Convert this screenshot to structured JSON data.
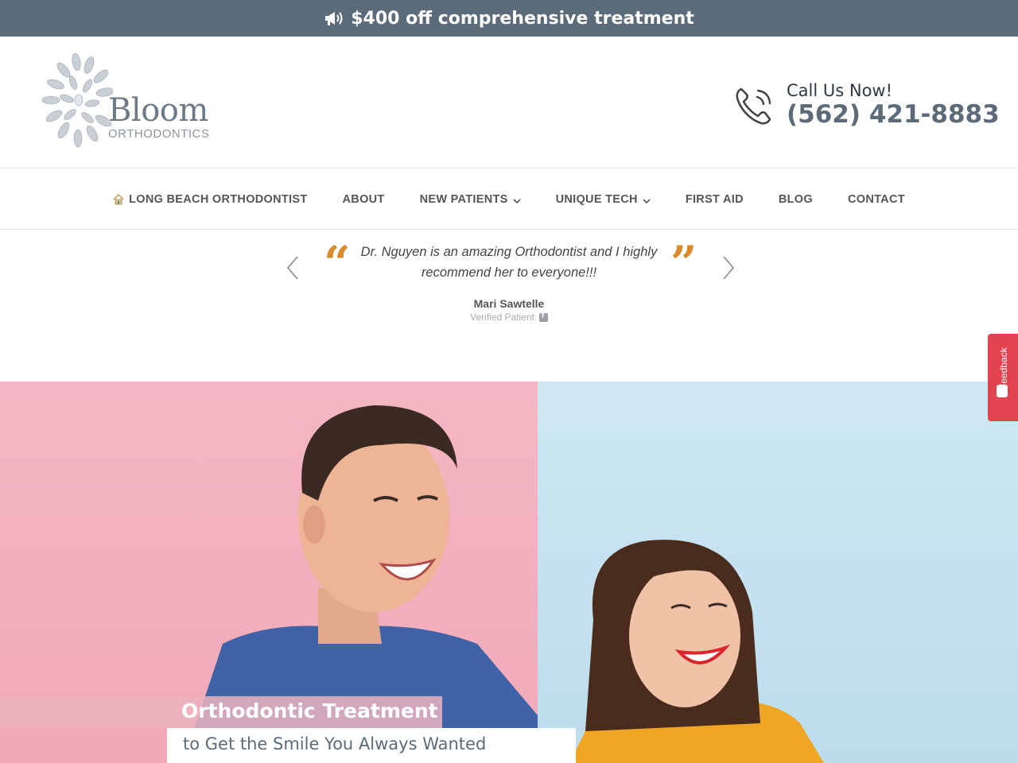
{
  "promo": {
    "text": "$400 off comprehensive treatment",
    "icon": "megaphone-icon"
  },
  "header": {
    "logo_main": "Bloom",
    "logo_sub": "ORTHODONTICS",
    "call_label": "Call Us Now!",
    "phone": "(562) 421-8883"
  },
  "nav": {
    "items": [
      {
        "label": "LONG BEACH ORTHODONTIST",
        "icon": "home-icon"
      },
      {
        "label": "ABOUT"
      },
      {
        "label": "NEW PATIENTS",
        "dropdown": true
      },
      {
        "label": "UNIQUE TECH",
        "dropdown": true
      },
      {
        "label": "FIRST AID"
      },
      {
        "label": "BLOG"
      },
      {
        "label": "CONTACT"
      }
    ]
  },
  "testimonial": {
    "quote": "Dr. Nguyen is an amazing Orthodontist and I highly recommend her to everyone!!!",
    "open_mark": "“",
    "close_mark": "”",
    "author": "Mari Sawtelle",
    "badge": "Verified Patient"
  },
  "hero": {
    "caption_title": "Orthodontic Treatment",
    "caption_subtitle": "to Get the Smile You Always Wanted"
  },
  "feedback": {
    "label": "Feedback"
  },
  "colors": {
    "promo_bg": "#5b6b79",
    "accent_quote": "#d98b2b",
    "hero_pink": "#f4b6c4",
    "hero_blue": "#cfe7f3",
    "feedback_red": "#e0454f"
  }
}
